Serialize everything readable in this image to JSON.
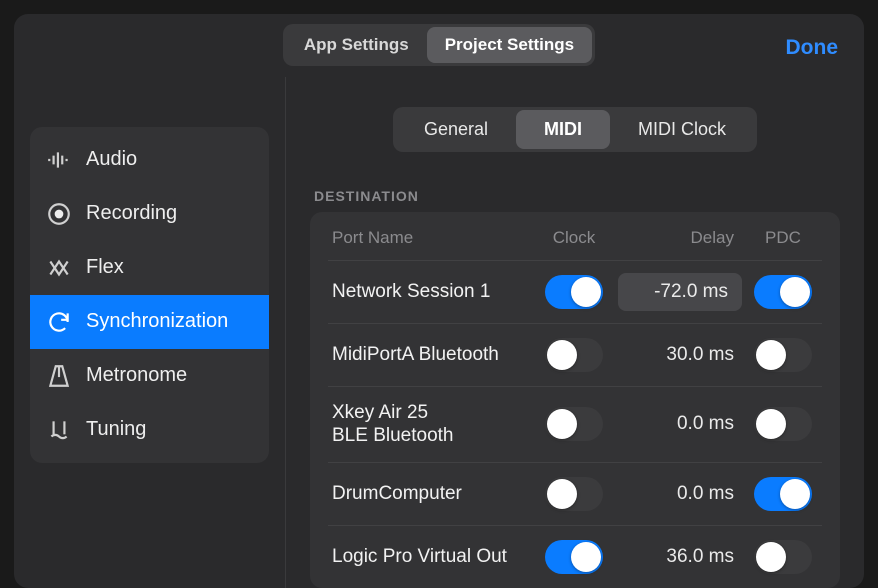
{
  "colors": {
    "accent": "#0a7cff",
    "done": "#2f8cff"
  },
  "topTabs": {
    "app": "App Settings",
    "project": "Project Settings",
    "active": "project"
  },
  "doneLabel": "Done",
  "sidebar": {
    "items": [
      {
        "label": "Audio",
        "icon": "audio"
      },
      {
        "label": "Recording",
        "icon": "recording"
      },
      {
        "label": "Flex",
        "icon": "flex"
      },
      {
        "label": "Synchronization",
        "icon": "sync"
      },
      {
        "label": "Metronome",
        "icon": "metronome"
      },
      {
        "label": "Tuning",
        "icon": "tuning"
      }
    ],
    "activeIndex": 3
  },
  "subTabs": {
    "items": [
      "General",
      "MIDI",
      "MIDI Clock"
    ],
    "activeIndex": 1
  },
  "section": {
    "heading": "DESTINATION"
  },
  "columns": {
    "port": "Port Name",
    "clock": "Clock",
    "delay": "Delay",
    "pdc": "PDC"
  },
  "rows": [
    {
      "port": "Network Session 1",
      "clock": true,
      "delay": "-72.0 ms",
      "delayEditable": true,
      "pdc": true
    },
    {
      "port": "MidiPortA Bluetooth",
      "clock": false,
      "delay": "30.0 ms",
      "delayEditable": false,
      "pdc": false
    },
    {
      "port": "Xkey Air 25\nBLE Bluetooth",
      "clock": false,
      "delay": "0.0 ms",
      "delayEditable": false,
      "pdc": false
    },
    {
      "port": "DrumComputer",
      "clock": false,
      "delay": "0.0 ms",
      "delayEditable": false,
      "pdc": true
    },
    {
      "port": "Logic Pro Virtual Out",
      "clock": true,
      "delay": "36.0 ms",
      "delayEditable": false,
      "pdc": false
    }
  ]
}
